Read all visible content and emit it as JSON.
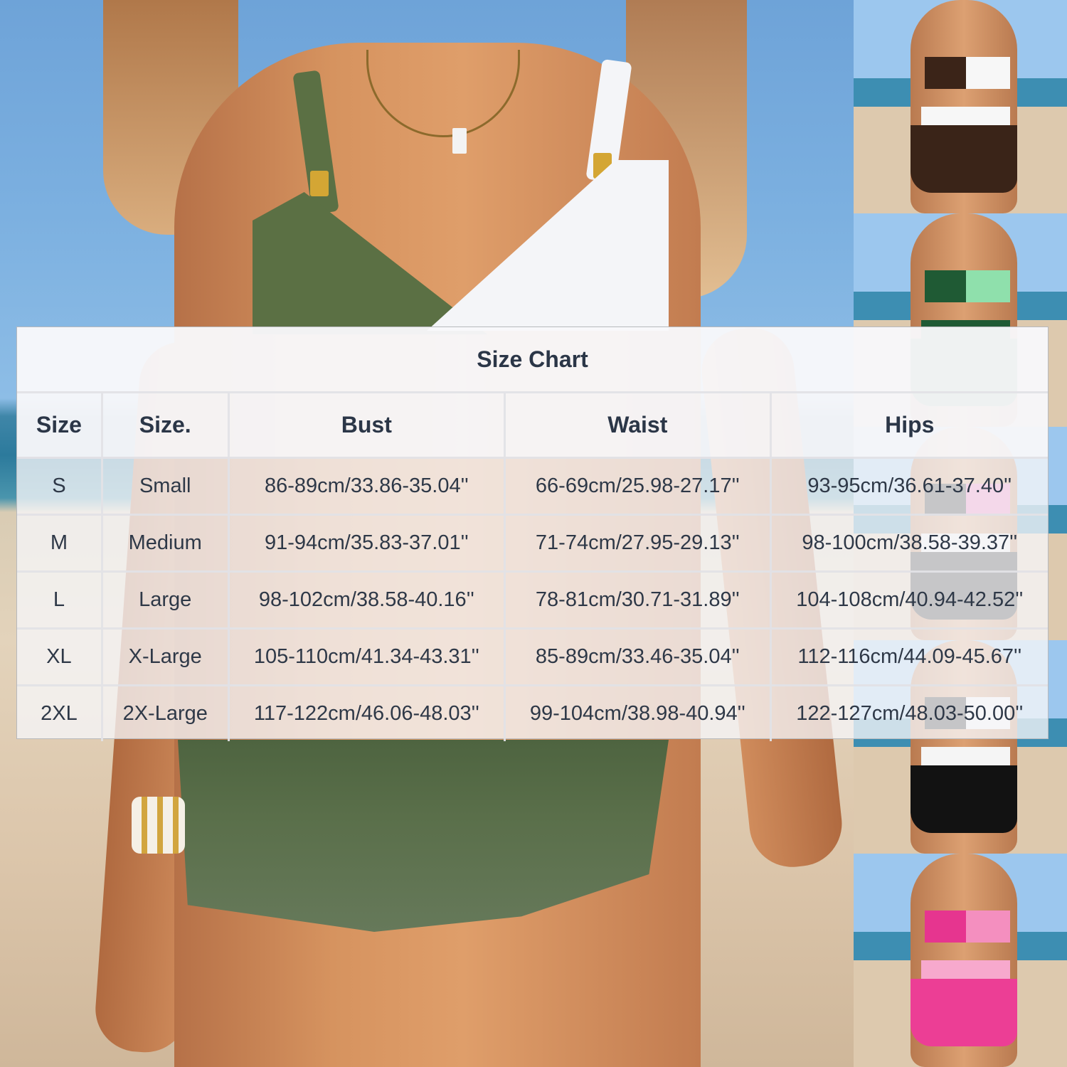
{
  "size_chart": {
    "title": "Size Chart",
    "headers": [
      "Size",
      "Size.",
      "Bust",
      "Waist",
      "Hips"
    ],
    "rows": [
      [
        "S",
        "Small",
        "86-89cm/33.86-35.04''",
        "66-69cm/25.98-27.17''",
        "93-95cm/36.61-37.40''"
      ],
      [
        "M",
        "Medium",
        "91-94cm/35.83-37.01''",
        "71-74cm/27.95-29.13''",
        "98-100cm/38.58-39.37''"
      ],
      [
        "L",
        "Large",
        "98-102cm/38.58-40.16''",
        "78-81cm/30.71-31.89''",
        "104-108cm/40.94-42.52''"
      ],
      [
        "XL",
        "X-Large",
        "105-110cm/41.34-43.31''",
        "85-89cm/33.46-35.04''",
        "112-116cm/44.09-45.67''"
      ],
      [
        "2XL",
        "2X-Large",
        "117-122cm/46.06-48.03''",
        "99-104cm/38.98-40.94''",
        "122-127cm/48.03-50.00''"
      ]
    ]
  },
  "product_photo": {
    "colors": {
      "main_outfit": "#5b7044",
      "accent_white": "#f4f5f8",
      "hardware_gold": "#d4a634"
    }
  },
  "color_variants": [
    {
      "name": "brown-white",
      "top_left": "#3b2418",
      "top_right": "#f7f7f7",
      "band": "#f7f7f7",
      "skirt": "#3a2418"
    },
    {
      "name": "green-mint",
      "top_left": "#1f5a34",
      "top_right": "#8fe0ac",
      "band": "#1f5a34",
      "skirt": "#1f5a34"
    },
    {
      "name": "black-pink",
      "top_left": "#1d1d1d",
      "top_right": "#ec6fb6",
      "band": "#f2f2f2",
      "skirt": "#1d1d1d"
    },
    {
      "name": "black-white",
      "top_left": "#1a1a1a",
      "top_right": "#f5f5f5",
      "band": "#f5f5f5",
      "skirt": "#121212"
    },
    {
      "name": "pink",
      "top_left": "#e6358f",
      "top_right": "#f48fbf",
      "band": "#f7a9cd",
      "skirt": "#ec3e95"
    }
  ]
}
